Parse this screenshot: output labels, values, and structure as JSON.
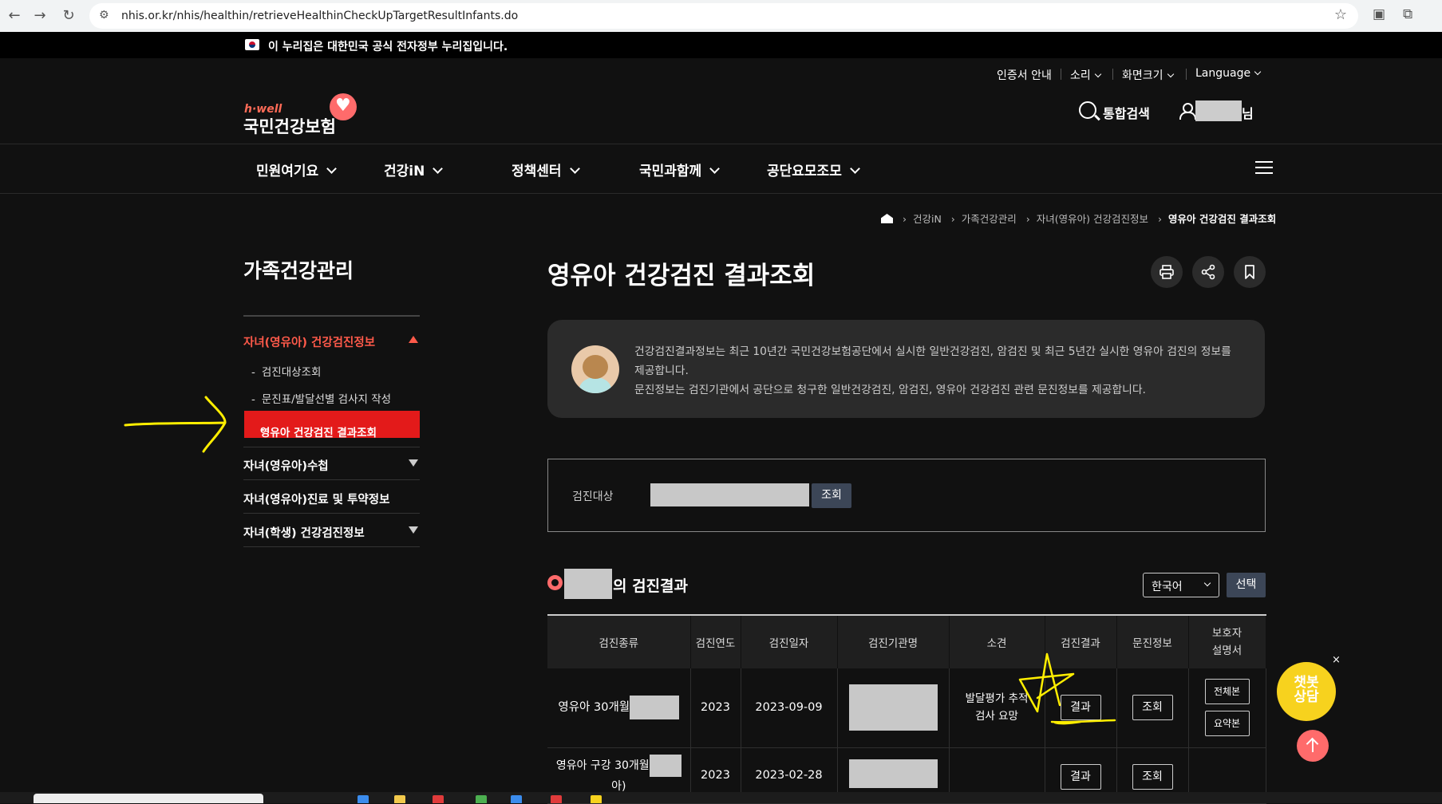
{
  "browser": {
    "url": "nhis.or.kr/nhis/healthin/retrieveHealthinCheckUpTargetResultInfants.do",
    "back": "←",
    "forward": "→",
    "reload": "↻",
    "star": "☆"
  },
  "gov_banner": "이 누리집은 대한민국 공식 전자정부 누리집입니다.",
  "header": {
    "util": [
      "인증서 안내",
      "소리",
      "화면크기",
      "Language"
    ],
    "logo_sub": "h·well",
    "logo_main": "국민건강보험",
    "search_label": "통합검색",
    "user_suffix": "님"
  },
  "gnb": [
    "민원여기요",
    "건강iN",
    "정책센터",
    "국민과함께",
    "공단요모조모"
  ],
  "breadcrumb": [
    "건강iN",
    "가족건강관리",
    "자녀(영유아) 건강검진정보",
    "영유아 건강검진 결과조회"
  ],
  "sidebar": {
    "title": "가족건강관리",
    "section_active": "자녀(영유아) 건강검진정보",
    "sub_items": [
      "검진대상조회",
      "문진표/발달선별 검사지 작성",
      "영유아 건강검진 결과조회"
    ],
    "sections": [
      "자녀(영유아)수첩",
      "자녀(영유아)진료 및 투약정보",
      "자녀(학생) 건강검진정보"
    ],
    "dash": "-"
  },
  "main": {
    "title": "영유아 건강검진 결과조회",
    "info_lines": [
      "건강검진결과정보는 최근 10년간 국민건강보험공단에서 실시한 일반건강검진, 암검진 및 최근 5년간 실시한 영유아 검진의 정보를",
      "제공합니다.",
      "문진정보는 검진기관에서 공단으로 청구한 일반건강검진, 암검진, 영유아 건강검진 관련 문진정보를 제공합니다."
    ],
    "query_label": "검진대상",
    "query_button": "조회",
    "result_heading_suffix": "의 검진결과",
    "language_value": "한국어",
    "language_button": "선택"
  },
  "table": {
    "headers": [
      "검진종류",
      "검진연도",
      "검진일자",
      "검진기관명",
      "소견",
      "검진결과",
      "문진정보",
      "보호자\n설명서"
    ],
    "rows": [
      {
        "type": "영유아 30개월",
        "year": "2023",
        "date": "2023-09-09",
        "opinion": "발달평가 추적\n검사 요망",
        "result_btn": "결과",
        "survey_btn": "조회",
        "guide_full": "전체본",
        "guide_summary": "요약본"
      },
      {
        "type": "영유아 구강 30개월",
        "type_tail": "아)",
        "year": "2023",
        "date": "2023-02-28",
        "opinion": "",
        "result_btn": "결과",
        "survey_btn": "조회"
      }
    ]
  },
  "chatbot": {
    "label": "챗봇\n상담",
    "close": "×"
  },
  "colors": {
    "accent_red": "#e31a1a",
    "accent_coral": "#ff6b6b",
    "chatbot_yellow": "#f7d21e",
    "annotation_yellow": "#ffee00"
  }
}
